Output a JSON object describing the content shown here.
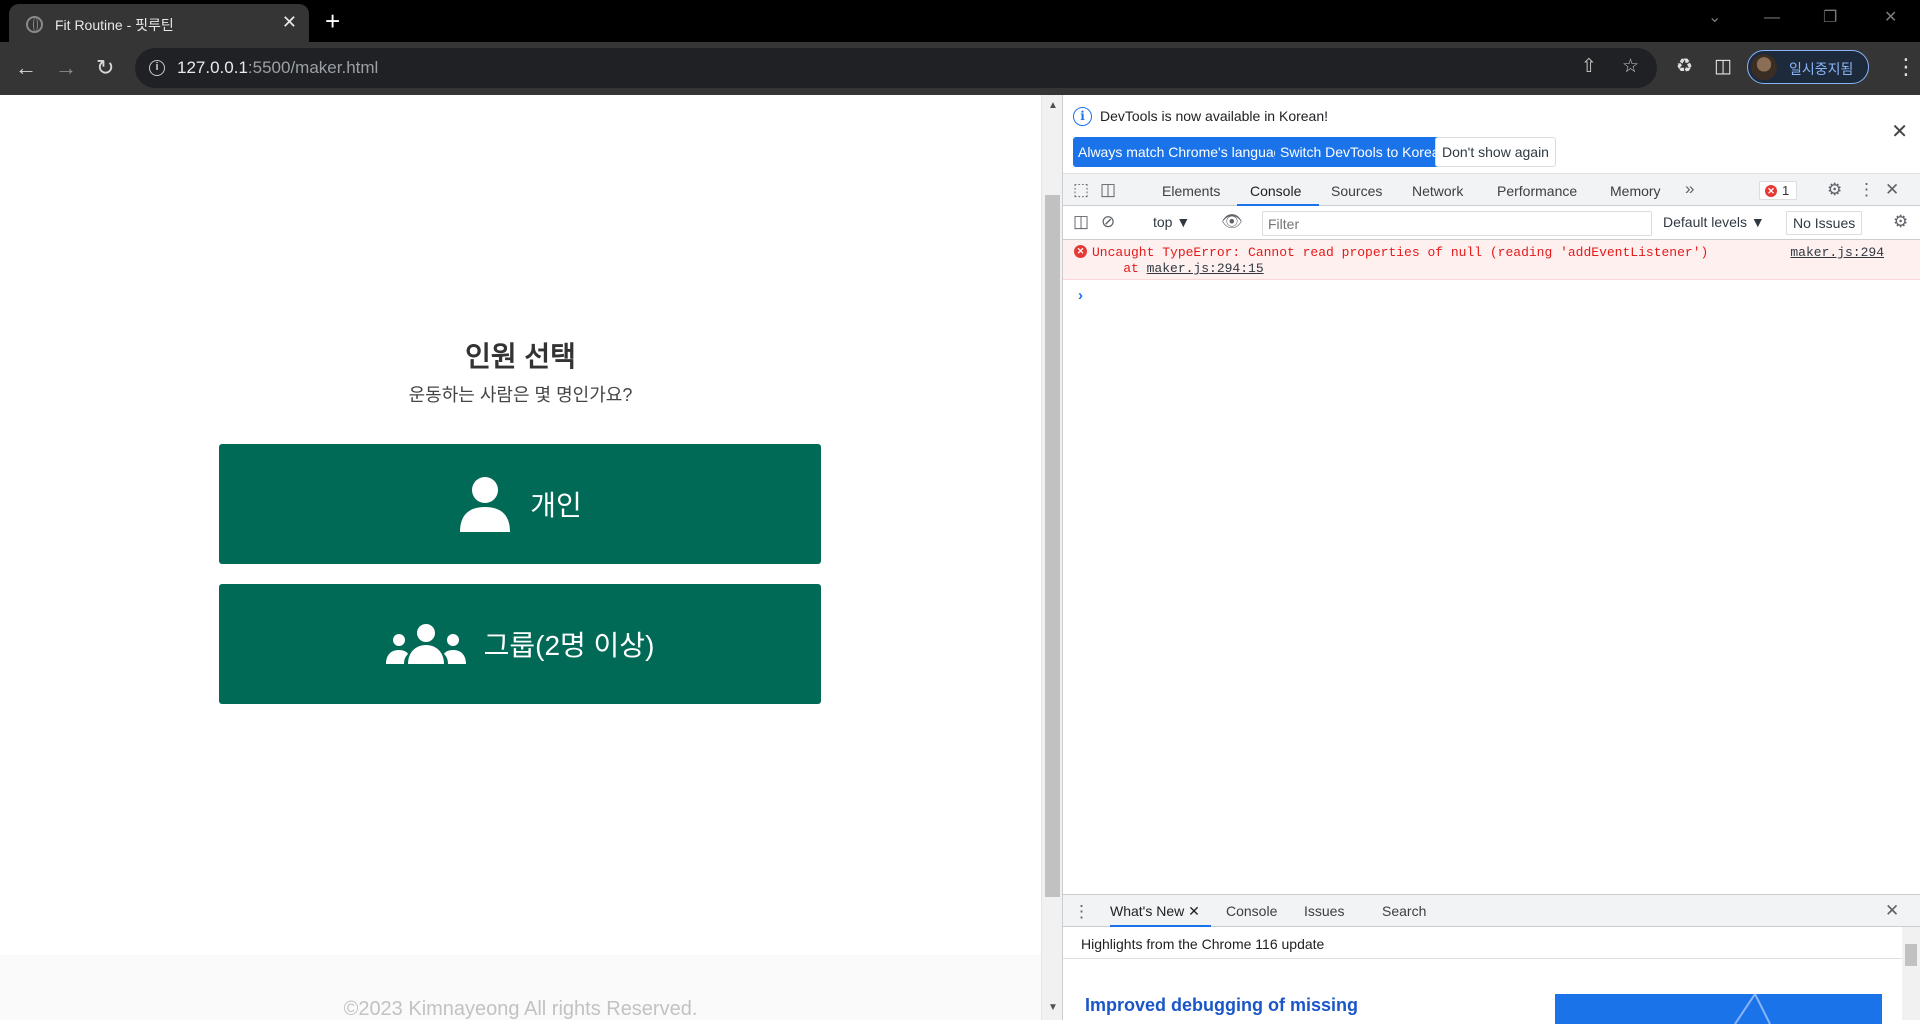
{
  "browser": {
    "tab_title": "Fit Routine - 핏루틴",
    "tab_close": "✕",
    "new_tab": "+",
    "url_host": "127.0.0.1",
    "url_rest": ":5500/maker.html",
    "profile_label": "일시중지됨"
  },
  "page": {
    "heading": "인원 선택",
    "subheading": "운동하는 사람은 몇 명인가요?",
    "options": [
      {
        "label": "개인",
        "icon": "person-icon"
      },
      {
        "label": "그룹(2명 이상)",
        "icon": "users-icon"
      }
    ],
    "footer": "©2023 Kimnayeong All rights Reserved."
  },
  "devtools": {
    "infobar": {
      "message": "DevTools is now available in Korean!",
      "match_button": "Always match Chrome's language",
      "switch_button": "Switch DevTools to Korean",
      "dismiss_button": "Don't show again"
    },
    "tabs": [
      "Elements",
      "Console",
      "Sources",
      "Network",
      "Performance",
      "Memory"
    ],
    "active_tab": "Console",
    "error_count": "1",
    "console_toolbar": {
      "context": "top",
      "filter_placeholder": "Filter",
      "levels": "Default levels",
      "issues": "No Issues"
    },
    "error": {
      "message": "Uncaught TypeError: Cannot read properties of null (reading 'addEventListener')",
      "at_prefix": "    at ",
      "location": "maker.js:294:15",
      "source": "maker.js:294"
    },
    "drawer": {
      "tabs": [
        "What's New",
        "Console",
        "Issues",
        "Search"
      ],
      "active_tab": "What's New",
      "highlights": "Highlights from the Chrome 116 update",
      "article_title": "Improved debugging of missing"
    }
  },
  "colors": {
    "accent_green": "#006a56",
    "devtools_blue": "#1a73e8",
    "error_red": "#e41a1a"
  }
}
